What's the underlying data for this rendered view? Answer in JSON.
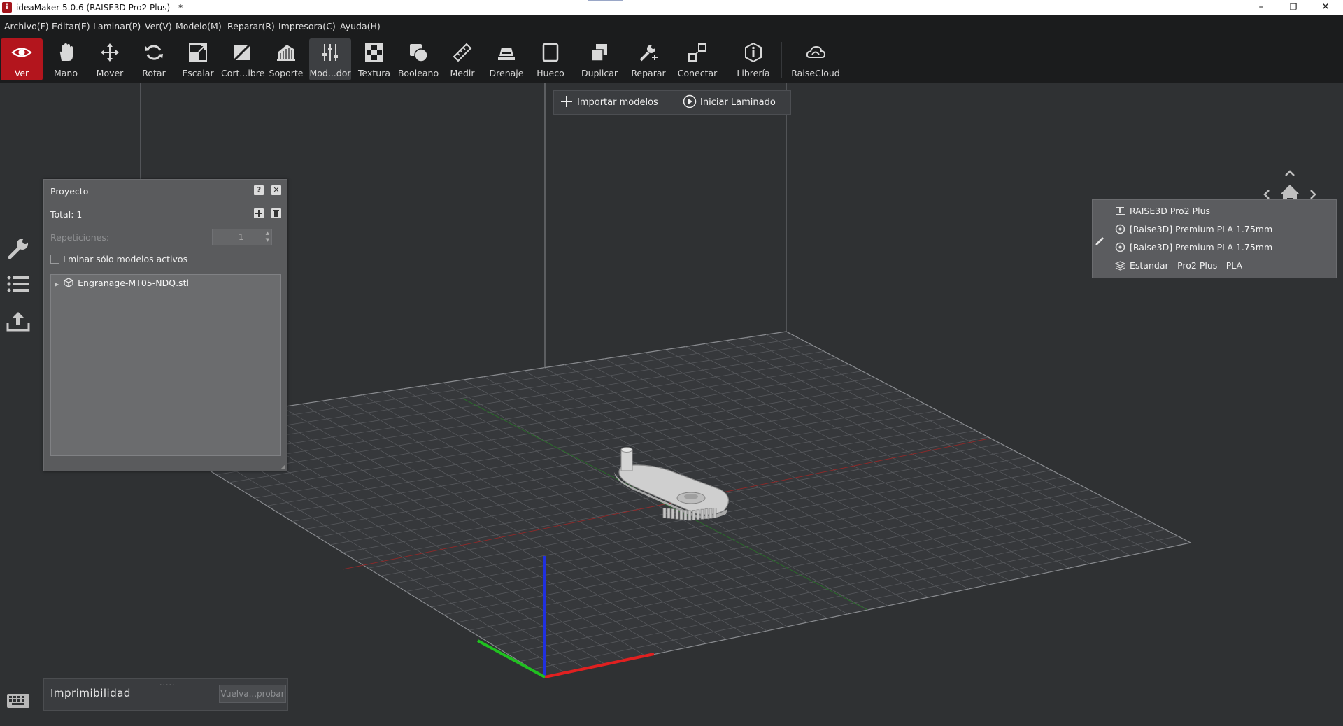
{
  "window": {
    "title": "ideaMaker 5.0.6 (RAISE3D Pro2 Plus) - *",
    "logo_letter": "i",
    "minimize": "–",
    "restore": "❐",
    "close": "✕"
  },
  "menu": [
    "Archivo(F)",
    "Editar(E)",
    "Laminar(P)",
    "Ver(V)",
    "Modelo(M)",
    "Reparar(R)",
    "Impresora(C)",
    "Ayuda(H)"
  ],
  "toolbar": [
    {
      "label": "Ver",
      "icon": "eye-icon",
      "state": "active"
    },
    {
      "label": "Mano",
      "icon": "hand-icon"
    },
    {
      "label": "Mover",
      "icon": "move-icon"
    },
    {
      "label": "Rotar",
      "icon": "rotate-icon"
    },
    {
      "label": "Escalar",
      "icon": "scale-icon"
    },
    {
      "label": "Cort...ibre",
      "icon": "cut-icon"
    },
    {
      "label": "Soporte",
      "icon": "support-icon"
    },
    {
      "label": "Mod...dor",
      "icon": "modifier-icon",
      "state": "selected"
    },
    {
      "label": "Textura",
      "icon": "texture-icon"
    },
    {
      "label": "Booleano",
      "icon": "boolean-icon"
    },
    {
      "label": "Medir",
      "icon": "ruler-icon"
    },
    {
      "label": "Drenaje",
      "icon": "drain-icon"
    },
    {
      "label": "Hueco",
      "icon": "hollow-icon"
    },
    {
      "label": "Duplicar",
      "icon": "duplicate-icon"
    },
    {
      "label": "Reparar",
      "icon": "repair-icon"
    },
    {
      "label": "Conectar",
      "icon": "connect-icon"
    },
    {
      "label": "Librería",
      "icon": "library-icon"
    },
    {
      "label": "RaiseCloud",
      "icon": "cloud-icon"
    }
  ],
  "quickbar": {
    "import_label": "Importar modelos",
    "slice_label": "Iniciar Laminado"
  },
  "project": {
    "title": "Proyecto",
    "help": "?",
    "close": "✕",
    "total_label": "Total: 1",
    "repetitions_label": "Repeticiones:",
    "repetitions_value": "1",
    "slice_active_label": "Lminar sólo modelos activos",
    "slice_active_checked": false,
    "models": [
      {
        "name": "Engranage-MT05-NDQ.stl"
      }
    ]
  },
  "print_info": {
    "printer": "RAISE3D Pro2 Plus",
    "filament_left": "[Raise3D] Premium PLA 1.75mm",
    "filament_right": "[Raise3D] Premium PLA 1.75mm",
    "profile": "Estandar - Pro2 Plus - PLA"
  },
  "printability": {
    "title": "Imprimibilidad",
    "grip": "·····",
    "button": "Vuelva...probar"
  },
  "colors": {
    "accent_red": "#b3151d",
    "axis_x": "#e02020",
    "axis_y": "#20c020",
    "axis_z": "#2030e0"
  }
}
